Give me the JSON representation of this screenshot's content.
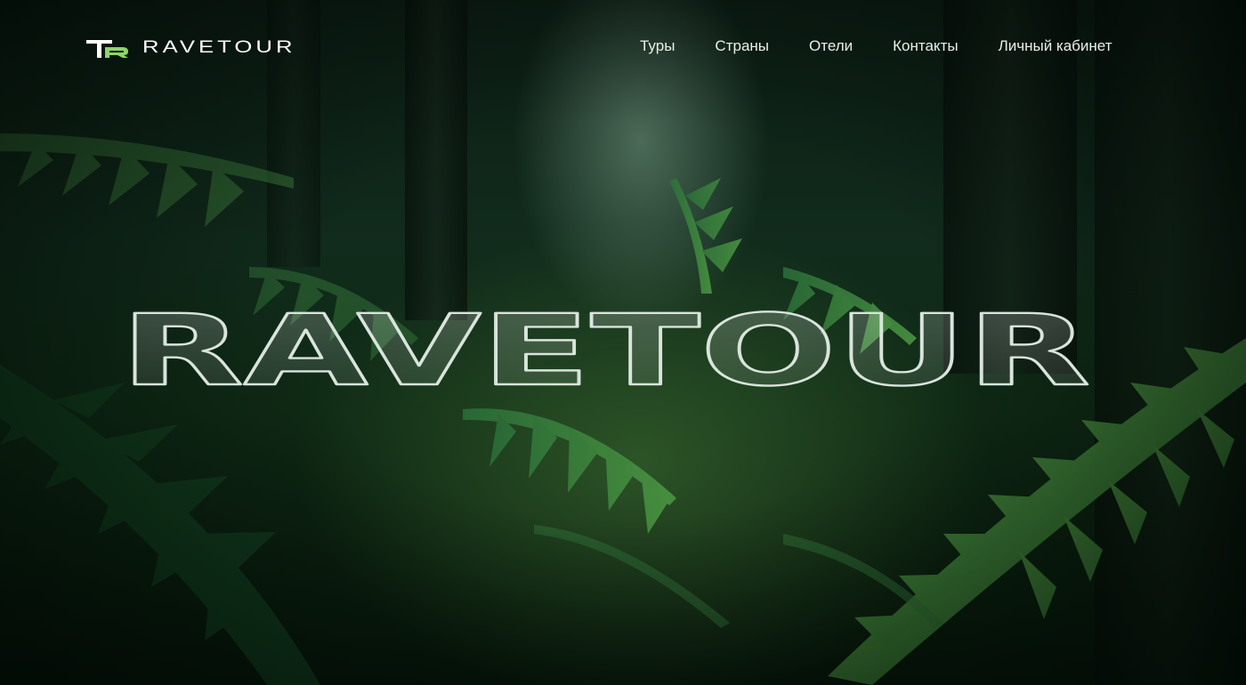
{
  "header": {
    "logo_text": "RAVETOUR",
    "nav": [
      {
        "label": "Туры"
      },
      {
        "label": "Страны"
      },
      {
        "label": "Отели"
      },
      {
        "label": "Контакты"
      },
      {
        "label": "Личный кабинет"
      }
    ]
  },
  "hero": {
    "title": "RAVETOUR"
  },
  "colors": {
    "accent": "#8fd36a",
    "text": "#ffffff",
    "background": "#0f2a15"
  },
  "icons": {
    "logo_mark": "tr-monogram-icon"
  }
}
